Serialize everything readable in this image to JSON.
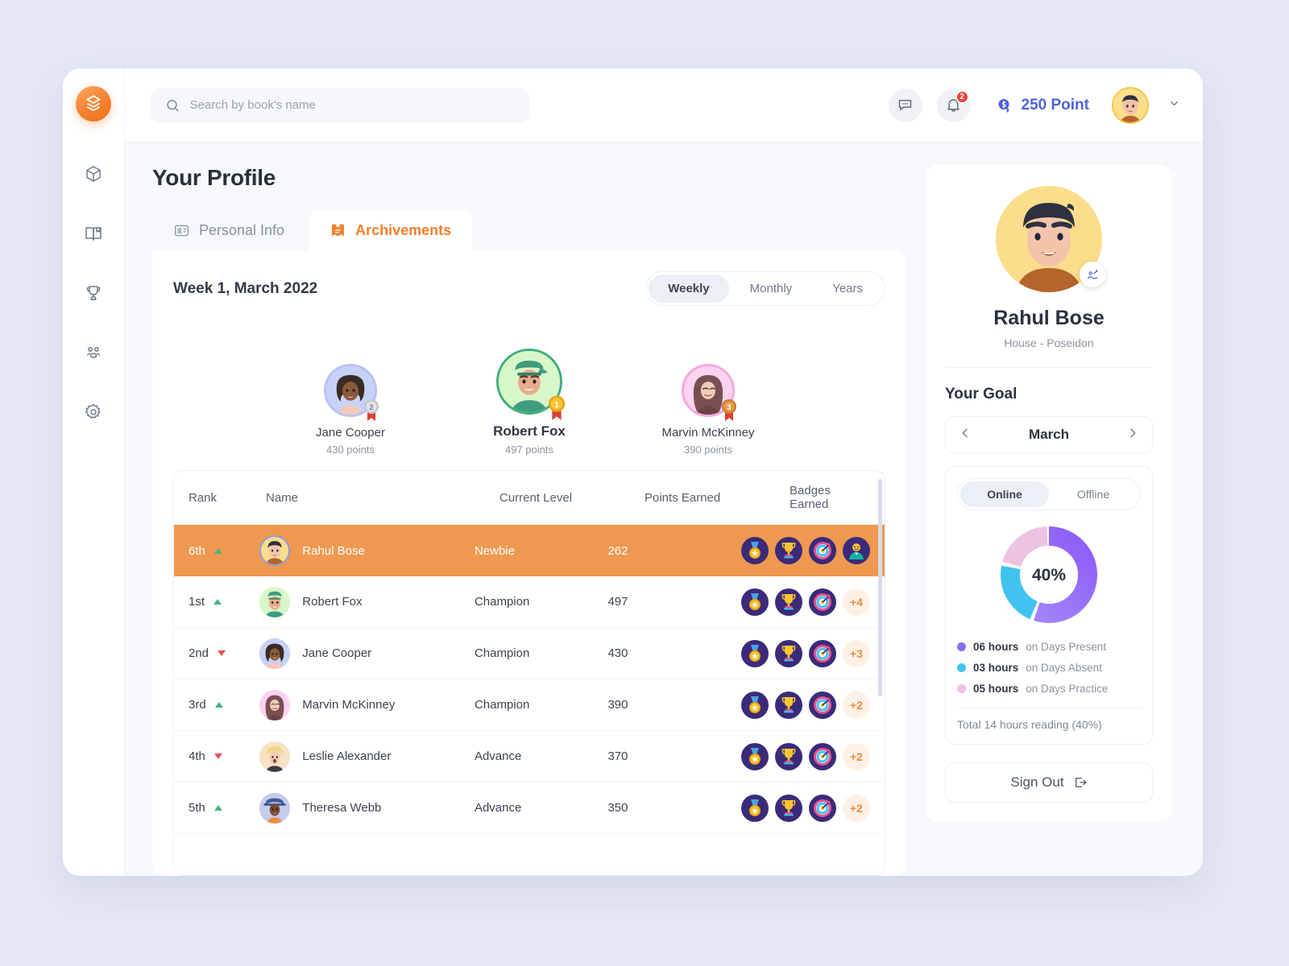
{
  "brand": {
    "logo_icon": "stacked-books-logo"
  },
  "sidebar": {
    "items": [
      {
        "icon": "cube-icon",
        "name": "dashboard"
      },
      {
        "icon": "book-open-icon",
        "name": "library"
      },
      {
        "icon": "trophy-icon",
        "name": "achievements"
      },
      {
        "icon": "people-group-icon",
        "name": "community"
      },
      {
        "icon": "gear-icon",
        "name": "settings"
      }
    ]
  },
  "topbar": {
    "search": {
      "placeholder": "Search by book's name",
      "value": "",
      "icon": "search-icon"
    },
    "chat_icon": "chat-bubble-icon",
    "bell_icon": "bell-icon",
    "bell_badge": "2",
    "points_icon": "coin-dollar-icon",
    "points_label": "250 Point",
    "points_color": "#4f64d8",
    "chevron_icon": "chevron-down-icon"
  },
  "page": {
    "title": "Your Profile",
    "tabs": [
      {
        "label": "Personal Info",
        "icon": "id-card-icon",
        "active": false
      },
      {
        "label": "Archivements",
        "icon": "badge-book-icon",
        "active": true
      }
    ]
  },
  "leaderboard": {
    "week_label": "Week 1, March 2022",
    "range_options": [
      {
        "label": "Weekly",
        "active": true
      },
      {
        "label": "Monthly",
        "active": false
      },
      {
        "label": "Years",
        "active": false
      }
    ],
    "podium": [
      {
        "name": "Jane Cooper",
        "points": "430 points",
        "medal": "2",
        "place": 2,
        "ring": "#b9c2ef",
        "bg": "#c8d2f7"
      },
      {
        "name": "Robert Fox",
        "points": "497 points",
        "medal": "1",
        "place": 1,
        "ring": "#3fae7d",
        "bg": "#d7f7c9"
      },
      {
        "name": "Marvin McKinney",
        "points": "390 points",
        "medal": "3",
        "place": 3,
        "ring": "#f3a9dd",
        "bg": "#fbd3f0"
      }
    ],
    "columns": [
      "Rank",
      "Name",
      "Current Level",
      "Points Earned",
      "Badges Earned"
    ],
    "rows": [
      {
        "rank": "6th",
        "trend": "up",
        "name": "Rahul Bose",
        "level": "Newbie",
        "points": "262",
        "badges": [
          "medal-badge-icon",
          "trophy-badge-icon",
          "target-badge-icon",
          "person-badge-icon"
        ],
        "more": "",
        "highlight": true,
        "av_bg": "#fbdd8b"
      },
      {
        "rank": "1st",
        "trend": "up",
        "name": "Robert Fox",
        "level": "Champion",
        "points": "497",
        "badges": [
          "medal-badge-icon",
          "trophy-badge-icon",
          "target-badge-icon"
        ],
        "more": "+4",
        "highlight": false,
        "av_bg": "#d7f7c9"
      },
      {
        "rank": "2nd",
        "trend": "down",
        "name": "Jane Cooper",
        "level": "Champion",
        "points": "430",
        "badges": [
          "medal-badge-icon",
          "trophy-badge-icon",
          "target-badge-icon"
        ],
        "more": "+3",
        "highlight": false,
        "av_bg": "#c8d2f7"
      },
      {
        "rank": "3rd",
        "trend": "up",
        "name": "Marvin McKinney",
        "level": "Champion",
        "points": "390",
        "badges": [
          "medal-badge-icon",
          "trophy-badge-icon",
          "target-badge-icon"
        ],
        "more": "+2",
        "highlight": false,
        "av_bg": "#fbd3f0"
      },
      {
        "rank": "4th",
        "trend": "down",
        "name": "Leslie Alexander",
        "level": "Advance",
        "points": "370",
        "badges": [
          "medal-badge-icon",
          "trophy-badge-icon",
          "target-badge-icon"
        ],
        "more": "+2",
        "highlight": false,
        "av_bg": "#f6e2c4"
      },
      {
        "rank": "5th",
        "trend": "up",
        "name": "Theresa Webb",
        "level": "Advance",
        "points": "350",
        "badges": [
          "medal-badge-icon",
          "trophy-badge-icon",
          "target-badge-icon"
        ],
        "more": "+2",
        "highlight": false,
        "av_bg": "#c4cbec"
      }
    ]
  },
  "profile": {
    "name": "Rahul Bose",
    "house": "House - Poseidon",
    "edit_icon": "edit-profile-icon",
    "goal_title": "Your Goal",
    "month": "March",
    "prev_icon": "chevron-left-icon",
    "next_icon": "chevron-right-icon",
    "mode_options": [
      {
        "label": "Online",
        "active": true
      },
      {
        "label": "Offline",
        "active": false
      }
    ],
    "donut_center": "40%",
    "legend": [
      {
        "hours": "06 hours",
        "text": "on Days Present",
        "color": "#8b6ef0"
      },
      {
        "hours": "03 hours",
        "text": "on Days Absent",
        "color": "#41c3f0"
      },
      {
        "hours": "05 hours",
        "text": "on Days Practice",
        "color": "#edc3e4"
      }
    ],
    "total": "Total 14 hours reading (40%)",
    "signout_label": "Sign Out",
    "signout_icon": "logout-icon"
  },
  "chart_data": {
    "type": "pie",
    "title": "Your Goal — March reading breakdown",
    "center_label": "40%",
    "categories": [
      "on Days Present",
      "on Days Absent",
      "on Days Practice"
    ],
    "values": [
      6,
      3,
      5
    ],
    "value_labels": [
      "06 hours",
      "03 hours",
      "05 hours"
    ],
    "colors": [
      "#8b6ef0",
      "#41c3f0",
      "#edc3e4"
    ],
    "unit": "hours",
    "total": 14,
    "total_label": "Total 14 hours reading (40%)",
    "legend_position": "bottom",
    "donut": true
  }
}
